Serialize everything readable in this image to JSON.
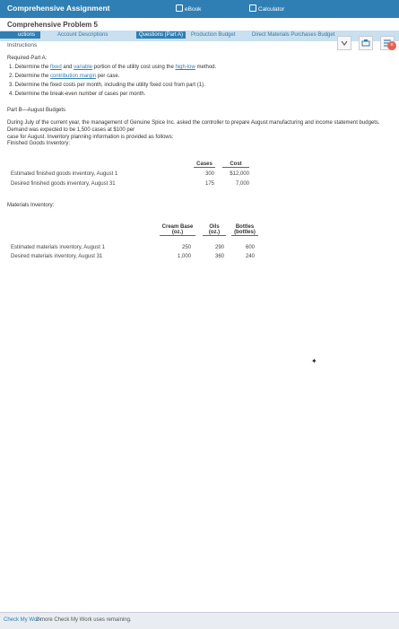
{
  "header": {
    "title": "Comprehensive Assignment",
    "ebook": "eBook",
    "calculator": "Calculator"
  },
  "subtitle": "Comprehensive Problem 5",
  "tabs": [
    {
      "label": "uctions"
    },
    {
      "label": "Account Descriptions"
    },
    {
      "label": "Questions (Part A)"
    },
    {
      "label": "Production Budget"
    },
    {
      "label": "Direct Materials Purchases Budget"
    }
  ],
  "instructions_label": "Instructions",
  "partA": {
    "heading": "Required-Part A:",
    "items": [
      {
        "pre": "1. Determine the ",
        "link1": "fixed",
        "mid1": " and ",
        "link2": "variable",
        "mid2": " portion of the utility cost using the ",
        "link3": "high-low",
        "post": " method."
      },
      {
        "pre": "2. Determine the ",
        "link1": "contribution margin",
        "post": " per case."
      },
      {
        "text": "3. Determine the fixed costs per month, including the utility fixed cost from part (1)."
      },
      {
        "text": "4. Determine the break-even number of cases per month."
      }
    ]
  },
  "partB": {
    "heading": "Part B—August Budgets",
    "para1": "During July of the current year, the management of Genuine Spice Inc. asked the controller to prepare August manufacturing and income statement budgets. Demand was expected to be 1,500 cases at $100 per",
    "para2": "case for August. Inventory planning information is provided as follows:",
    "finished_label": "Finished Goods Inventory:",
    "fg_headers": {
      "cases": "Cases",
      "cost": "Cost"
    },
    "fg_rows": [
      {
        "label": "Estimated finished goods inventory, August 1",
        "cases": "300",
        "cost": "$12,000"
      },
      {
        "label": "Desired finished goods inventory, August 31",
        "cases": "175",
        "cost": "7,000"
      }
    ],
    "materials_label": "Materials Inventory:",
    "mat_headers": [
      {
        "l1": "Cream Base",
        "l2": "(oz.)"
      },
      {
        "l1": "Oils",
        "l2": "(oz.)"
      },
      {
        "l1": "Bottles",
        "l2": "(bottles)"
      }
    ],
    "mat_rows": [
      {
        "label": "Estimated materials inventory, August 1",
        "v": [
          "250",
          "290",
          "600"
        ]
      },
      {
        "label": "Desired materials inventory, August 31",
        "v": [
          "1,000",
          "360",
          "240"
        ]
      }
    ]
  },
  "footer": {
    "check": "Check My Work",
    "remaining": "2 more Check My Work uses remaining."
  },
  "colors": {
    "accent": "#2f7fb4",
    "tabbar": "#c8e0f0",
    "close": "#e8624f"
  }
}
